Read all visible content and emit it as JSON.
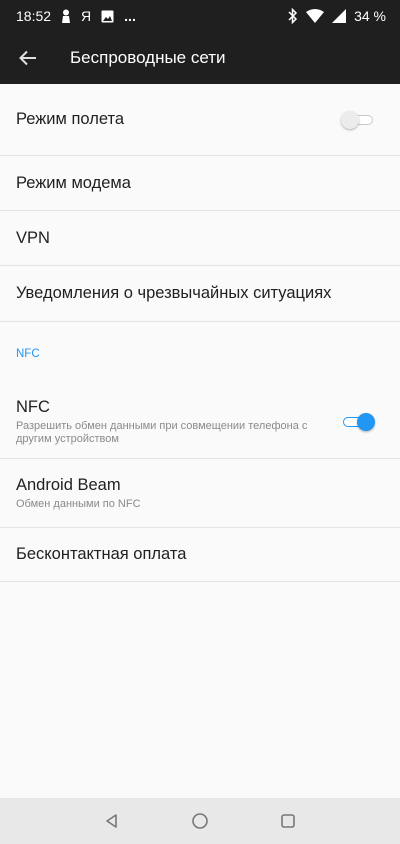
{
  "status_bar": {
    "time": "18:52",
    "ya_label": "Я",
    "more": "...",
    "battery": "34 %"
  },
  "app_bar": {
    "title": "Беспроводные сети"
  },
  "settings": {
    "airplane": {
      "title": "Режим полета",
      "enabled": false
    },
    "modem": {
      "title": "Режим модема"
    },
    "vpn": {
      "title": "VPN"
    },
    "emergency": {
      "title": "Уведомления о чрезвычайных ситуациях"
    },
    "nfc_section": "NFC",
    "nfc": {
      "title": "NFC",
      "subtitle": "Разрешить обмен данными при совмещении телефона с другим устройством",
      "enabled": true
    },
    "beam": {
      "title": "Android Beam",
      "subtitle": "Обмен данными по NFC"
    },
    "contactless": {
      "title": "Бесконтактная оплата"
    }
  },
  "colors": {
    "accent": "#2196f3",
    "bar": "#1f1f1f",
    "background": "#fafafa"
  },
  "icons": {
    "status_left": [
      "person-icon",
      "ya-icon",
      "image-icon",
      "more-icon"
    ],
    "status_right": [
      "bluetooth-icon",
      "wifi-icon",
      "cellular-icon"
    ],
    "nav": [
      "back-triangle-icon",
      "home-circle-icon",
      "recents-square-icon"
    ]
  }
}
